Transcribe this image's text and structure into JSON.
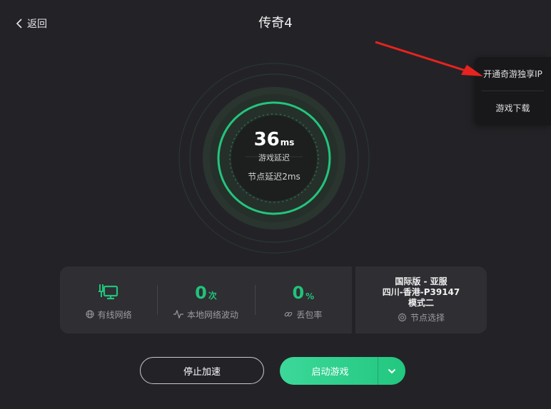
{
  "header": {
    "back_label": "返回",
    "title": "传奇4"
  },
  "side_menu": {
    "items": [
      {
        "label": "开通奇游独享IP"
      },
      {
        "label": "游戏下载"
      }
    ]
  },
  "gauge": {
    "latency_value": "36",
    "latency_unit": "ms",
    "latency_label": "游戏延迟",
    "node_latency": "节点延迟2ms"
  },
  "stats": [
    {
      "value": "",
      "unit": "",
      "label": "有线网络",
      "icon": "ethernet-icon"
    },
    {
      "value": "0",
      "unit": "次",
      "label": "本地网络波动",
      "icon": "pulse-icon"
    },
    {
      "value": "0",
      "unit": "%",
      "label": "丢包率",
      "icon": "link-icon"
    }
  ],
  "node": {
    "line1": "国际版 - 亚服",
    "line2": "四川-香港-P39147",
    "line3": "模式二",
    "select_label": "节点选择"
  },
  "buttons": {
    "stop_label": "停止加速",
    "start_label": "启动游戏"
  },
  "colors": {
    "background": "#232327",
    "accent": "#21c27a",
    "annotation_arrow": "#e8231f"
  }
}
